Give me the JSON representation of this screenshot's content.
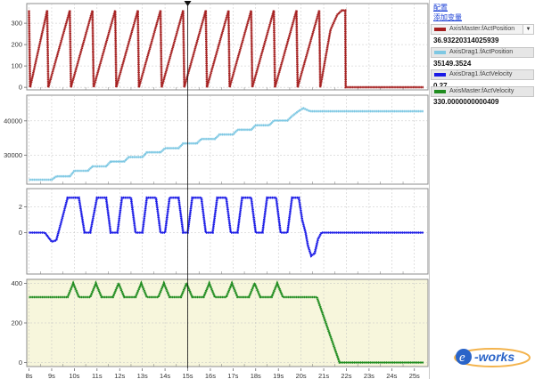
{
  "sidebar": {
    "config_link": "配置",
    "add_variable_link": "添加变量",
    "channels": [
      {
        "name": "AxisMaster.fActPosition",
        "value": "36.93220314025939",
        "color": "#a52020"
      },
      {
        "name": "AxisDrag1.fActPosition",
        "value": "35149.3524",
        "color": "#7ec8e3"
      },
      {
        "name": "AxisDrag1.fActVelocity",
        "value": "0.27",
        "color": "#1a1ae6"
      },
      {
        "name": "AxisMaster.fActVelocity",
        "value": "330.0000000000409",
        "color": "#1f8c1f"
      }
    ]
  },
  "time_axis": {
    "ticks": [
      "8s",
      "9s",
      "10s",
      "11s",
      "12s",
      "13s",
      "14s",
      "15s",
      "16s",
      "17s",
      "18s",
      "19s",
      "20s",
      "21s",
      "22s",
      "23s",
      "24s",
      "25s"
    ]
  },
  "cursor": {
    "time": 15.0
  },
  "chart_data": [
    {
      "type": "line",
      "series": [
        {
          "name": "AxisMaster.fActPosition"
        }
      ],
      "x_unit": "s",
      "xlim": [
        7.9,
        25.6
      ],
      "yticks": [
        "0",
        "100",
        "200",
        "300"
      ],
      "ylim": [
        -12,
        392
      ],
      "grid": true,
      "points": [
        [
          8.0,
          360
        ],
        [
          8.05,
          0
        ],
        [
          8.8,
          360
        ],
        [
          8.85,
          0
        ],
        [
          9.8,
          360
        ],
        [
          9.85,
          0
        ],
        [
          10.8,
          360
        ],
        [
          10.85,
          0
        ],
        [
          11.8,
          360
        ],
        [
          11.85,
          0
        ],
        [
          12.8,
          360
        ],
        [
          12.85,
          0
        ],
        [
          13.8,
          360
        ],
        [
          13.85,
          0
        ],
        [
          14.8,
          360
        ],
        [
          14.85,
          0
        ],
        [
          15.8,
          360
        ],
        [
          15.85,
          0
        ],
        [
          16.8,
          360
        ],
        [
          16.85,
          0
        ],
        [
          17.8,
          360
        ],
        [
          17.85,
          0
        ],
        [
          18.8,
          360
        ],
        [
          18.85,
          0
        ],
        [
          19.8,
          360
        ],
        [
          19.85,
          0
        ],
        [
          20.8,
          360
        ],
        [
          20.85,
          0
        ],
        [
          21.3,
          270
        ],
        [
          21.6,
          340
        ],
        [
          21.8,
          360
        ],
        [
          21.95,
          360
        ],
        [
          21.97,
          0
        ],
        [
          25.4,
          0
        ]
      ]
    },
    {
      "type": "line",
      "series": [
        {
          "name": "AxisDrag1.fActPosition"
        }
      ],
      "x_unit": "s",
      "xlim": [
        7.9,
        25.6
      ],
      "yticks": [
        "30000",
        "40000"
      ],
      "ylim": [
        21500,
        47500
      ],
      "grid": true,
      "points": [
        [
          8.0,
          22800
        ],
        [
          9.0,
          22800
        ],
        [
          9.2,
          23800
        ],
        [
          9.8,
          23800
        ],
        [
          10.0,
          25400
        ],
        [
          10.6,
          25400
        ],
        [
          10.8,
          26700
        ],
        [
          11.4,
          26700
        ],
        [
          11.6,
          28100
        ],
        [
          12.2,
          28100
        ],
        [
          12.4,
          29400
        ],
        [
          13.0,
          29400
        ],
        [
          13.2,
          30800
        ],
        [
          13.8,
          30800
        ],
        [
          14.0,
          32000
        ],
        [
          14.6,
          32000
        ],
        [
          14.8,
          33400
        ],
        [
          15.4,
          33400
        ],
        [
          15.6,
          34700
        ],
        [
          16.2,
          34700
        ],
        [
          16.4,
          36000
        ],
        [
          17.0,
          36000
        ],
        [
          17.2,
          37400
        ],
        [
          17.8,
          37400
        ],
        [
          18.0,
          38700
        ],
        [
          18.6,
          38700
        ],
        [
          18.8,
          40100
        ],
        [
          19.4,
          40100
        ],
        [
          19.6,
          41400
        ],
        [
          19.9,
          42900
        ],
        [
          20.1,
          43700
        ],
        [
          20.4,
          42800
        ],
        [
          25.4,
          42800
        ]
      ]
    },
    {
      "type": "line",
      "series": [
        {
          "name": "AxisDrag1.fActVelocity"
        }
      ],
      "x_unit": "s",
      "xlim": [
        7.9,
        25.6
      ],
      "yticks": [
        "0",
        "2"
      ],
      "ylim": [
        -3.2,
        3.4
      ],
      "grid": true,
      "points": [
        [
          8.0,
          0
        ],
        [
          8.7,
          0
        ],
        [
          9.0,
          -0.7
        ],
        [
          9.2,
          -0.6
        ],
        [
          9.45,
          1.0
        ],
        [
          9.7,
          2.7
        ],
        [
          10.2,
          2.7
        ],
        [
          10.45,
          0
        ],
        [
          10.7,
          0
        ],
        [
          11.0,
          2.7
        ],
        [
          11.4,
          2.7
        ],
        [
          11.6,
          0
        ],
        [
          11.9,
          0
        ],
        [
          12.1,
          2.7
        ],
        [
          12.5,
          2.7
        ],
        [
          12.7,
          0
        ],
        [
          13.0,
          0
        ],
        [
          13.2,
          2.7
        ],
        [
          13.6,
          2.7
        ],
        [
          13.8,
          0
        ],
        [
          14.0,
          0
        ],
        [
          14.2,
          2.7
        ],
        [
          14.6,
          2.7
        ],
        [
          14.8,
          0
        ],
        [
          15.0,
          0
        ],
        [
          15.2,
          2.7
        ],
        [
          15.6,
          2.7
        ],
        [
          15.8,
          0
        ],
        [
          16.1,
          0
        ],
        [
          16.3,
          2.7
        ],
        [
          16.7,
          2.7
        ],
        [
          16.9,
          0
        ],
        [
          17.2,
          0
        ],
        [
          17.4,
          2.7
        ],
        [
          17.8,
          2.7
        ],
        [
          18.0,
          0
        ],
        [
          18.3,
          0
        ],
        [
          18.5,
          2.7
        ],
        [
          18.9,
          2.7
        ],
        [
          19.1,
          0
        ],
        [
          19.4,
          0
        ],
        [
          19.6,
          2.7
        ],
        [
          19.9,
          2.7
        ],
        [
          20.05,
          1.0
        ],
        [
          20.2,
          0
        ],
        [
          20.3,
          -1.0
        ],
        [
          20.45,
          -1.8
        ],
        [
          20.6,
          -1.6
        ],
        [
          20.75,
          -0.5
        ],
        [
          20.9,
          0
        ],
        [
          25.4,
          0
        ]
      ]
    },
    {
      "type": "line",
      "series": [
        {
          "name": "AxisMaster.fActVelocity"
        }
      ],
      "x_unit": "s",
      "xlim": [
        7.9,
        25.6
      ],
      "yticks": [
        "0",
        "200",
        "400"
      ],
      "ylim": [
        -20,
        420
      ],
      "grid": true,
      "points": [
        [
          8.0,
          330
        ],
        [
          9.7,
          330
        ],
        [
          9.95,
          400
        ],
        [
          10.2,
          330
        ],
        [
          10.7,
          330
        ],
        [
          10.95,
          400
        ],
        [
          11.2,
          330
        ],
        [
          11.7,
          330
        ],
        [
          11.95,
          400
        ],
        [
          12.2,
          330
        ],
        [
          12.7,
          330
        ],
        [
          12.95,
          400
        ],
        [
          13.2,
          330
        ],
        [
          13.7,
          330
        ],
        [
          13.95,
          400
        ],
        [
          14.2,
          330
        ],
        [
          14.7,
          330
        ],
        [
          14.95,
          400
        ],
        [
          15.2,
          330
        ],
        [
          15.7,
          330
        ],
        [
          15.95,
          400
        ],
        [
          16.2,
          330
        ],
        [
          16.7,
          330
        ],
        [
          16.95,
          400
        ],
        [
          17.2,
          330
        ],
        [
          17.7,
          330
        ],
        [
          17.95,
          400
        ],
        [
          18.2,
          330
        ],
        [
          18.7,
          330
        ],
        [
          18.95,
          400
        ],
        [
          19.2,
          330
        ],
        [
          20.7,
          330
        ],
        [
          21.7,
          0
        ],
        [
          25.4,
          0
        ]
      ]
    }
  ]
}
